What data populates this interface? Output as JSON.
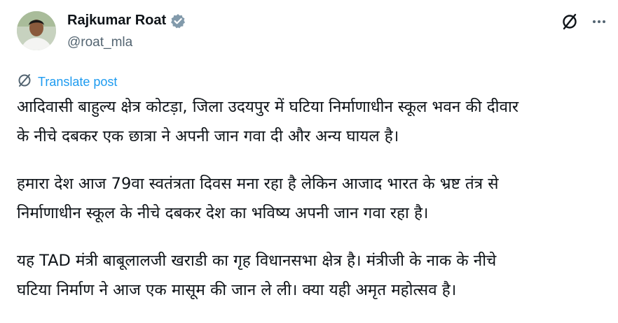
{
  "author": {
    "name": "Rajkumar Roat",
    "handle": "@roat_mla",
    "verified_color": "#829aab"
  },
  "actions": {
    "grok_icon": "grok-icon",
    "more_icon": "more-icon",
    "more_label": "···"
  },
  "translate": {
    "label": "Translate post",
    "color": "#1d9bf0"
  },
  "post": {
    "paragraphs": [
      {
        "lines": [
          "आदिवासी बाहुल्य क्षेत्र कोटड़ा, जिला उदयपुर में घटिया निर्माणाधीन स्कूल भवन की दीवार",
          "के नीचे दबकर एक छात्रा ने अपनी जान गवा दी और अन्य घायल है।"
        ]
      },
      {
        "lines": [
          "हमारा देश आज 79वा स्वतंत्रता दिवस मना रहा है लेकिन आजाद भारत के भ्रष्ट तंत्र से",
          "निर्माणाधीन स्कूल के नीचे दबकर देश का भविष्य अपनी जान गवा रहा है।"
        ]
      },
      {
        "lines": [
          "यह TAD मंत्री बाबूलालजी खराडी का गृह विधानसभा क्षेत्र है। मंत्रीजी के नाक के नीचे",
          "घटिया निर्माण ने आज एक मासूम की जान ले ली। क्या यही अमृत महोत्सव है।"
        ]
      }
    ]
  }
}
